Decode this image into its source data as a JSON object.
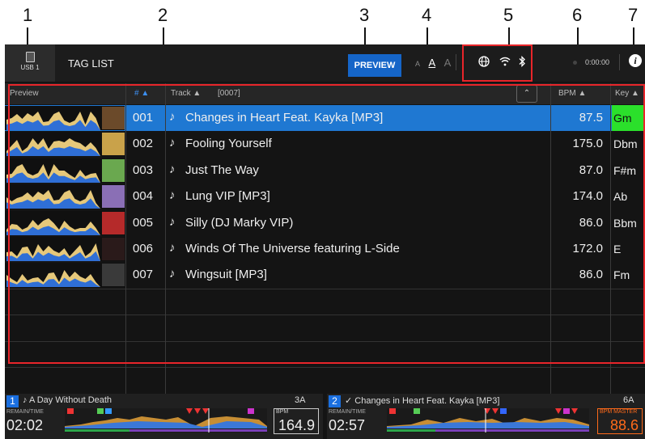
{
  "callouts": [
    "1",
    "2",
    "3",
    "4",
    "5",
    "6",
    "7"
  ],
  "topbar": {
    "usb_label": "USB 1",
    "tag_list": "TAG LIST",
    "preview": "PREVIEW",
    "font_sizes": [
      "A",
      "A",
      "A"
    ],
    "time": "0:00:00",
    "icons": [
      "globe-icon",
      "wifi-icon",
      "bluetooth-icon",
      "info-icon"
    ]
  },
  "header": {
    "preview": "Preview",
    "num": "# ▲",
    "track": "Track ▲",
    "count": "[0007]",
    "bpm": "BPM ▲",
    "key": "Key ▲"
  },
  "tracks": [
    {
      "num": "001",
      "title": "Changes in Heart Feat. Kayka [MP3]",
      "bpm": "87.5",
      "key": "Gm",
      "selected": true
    },
    {
      "num": "002",
      "title": "Fooling Yourself",
      "bpm": "175.0",
      "key": "Dbm",
      "selected": false
    },
    {
      "num": "003",
      "title": "Just The Way",
      "bpm": "87.0",
      "key": "F#m",
      "selected": false
    },
    {
      "num": "004",
      "title": "Lung VIP [MP3]",
      "bpm": "174.0",
      "key": "Ab",
      "selected": false
    },
    {
      "num": "005",
      "title": "Silly (DJ Marky VIP)",
      "bpm": "86.0",
      "key": "Bbm",
      "selected": false
    },
    {
      "num": "006",
      "title": "Winds Of The Universe featuring L-Side",
      "bpm": "172.0",
      "key": "E",
      "selected": false
    },
    {
      "num": "007",
      "title": "Wingsuit [MP3]",
      "bpm": "86.0",
      "key": "Fm",
      "selected": false
    }
  ],
  "decks": [
    {
      "num": "1",
      "title": "♪ A Day Without Death",
      "key": "3A",
      "remain_label": "REMAIN/TIME",
      "time": "02:02",
      "bpm_label": "BPM",
      "bpm": "164.9"
    },
    {
      "num": "2",
      "title": "✓ Changes in Heart Feat. Kayka [MP3]",
      "key": "6A",
      "remain_label": "REMAIN/TIME",
      "time": "02:57",
      "bpm_label": "BPM MASTER",
      "bpm": "88.6"
    }
  ],
  "colors": {
    "accent": "#1f78d2",
    "selected_key": "#2be02b",
    "highlight_frame": "#e8252a",
    "master": "#ff6a1a"
  }
}
